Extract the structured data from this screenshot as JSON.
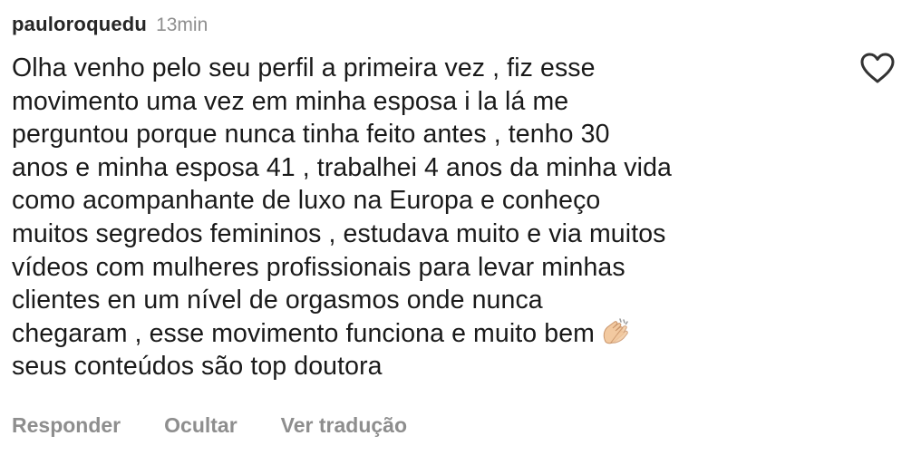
{
  "comment": {
    "username": "pauloroquedu",
    "timestamp": "13min",
    "lines": [
      "Olha venho pelo seu perfil a primeira vez , fiz esse",
      "movimento uma vez em minha esposa i la lá me",
      "perguntou porque nunca tinha feito antes , tenho 30",
      "anos e minha esposa 41 , trabalhei 4 anos da minha vida",
      "como acompanhante de luxo na Europa e conheço",
      "muitos segredos femininos , estudava muito e via muitos",
      "vídeos com mulheres profissionais para levar minhas",
      "clientes en um nível de orgasmos onde nunca",
      "chegaram , esse movimento funciona e muito bem",
      "seus conteúdos são top doutora"
    ],
    "emoji": "clapping-hands-emoji"
  },
  "actions": {
    "reply": "Responder",
    "hide": "Ocultar",
    "translate": "Ver tradução"
  },
  "icons": {
    "like": "heart-outline-icon"
  },
  "colors": {
    "text": "#1a1a1a",
    "muted": "#8e8e8e",
    "skin": "#f2c9a0"
  }
}
